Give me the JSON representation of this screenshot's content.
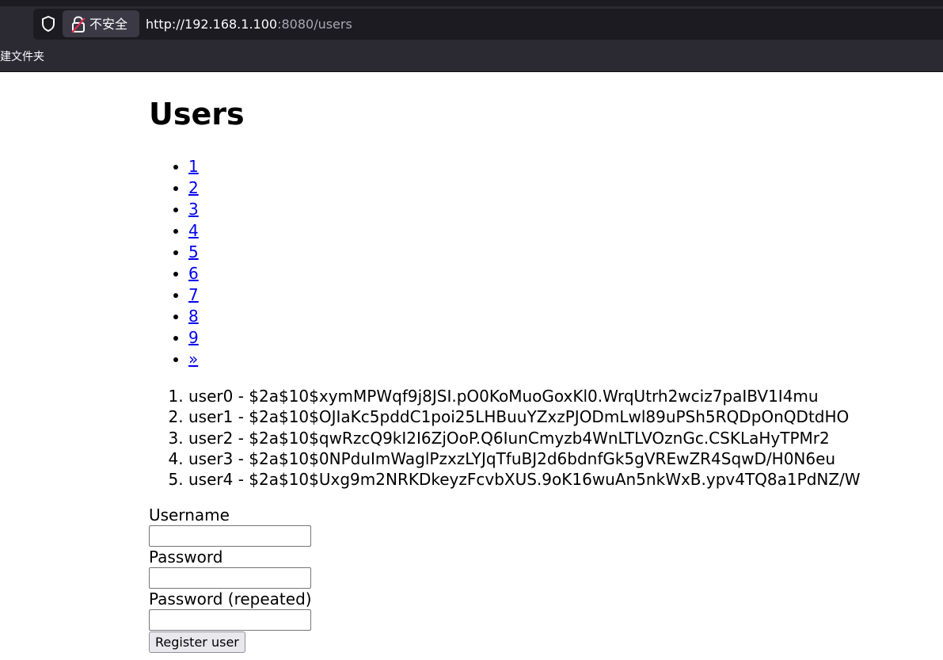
{
  "browser": {
    "security_label": "不安全",
    "url_host": "http://192.168.1.100",
    "url_rest": ":8080/users",
    "bookmark_label": "建文件夹"
  },
  "page": {
    "title": "Users",
    "pagination": [
      {
        "label": "1"
      },
      {
        "label": "2"
      },
      {
        "label": "3"
      },
      {
        "label": "4"
      },
      {
        "label": "5"
      },
      {
        "label": "6"
      },
      {
        "label": "7"
      },
      {
        "label": "8"
      },
      {
        "label": "9"
      },
      {
        "label": "»"
      }
    ],
    "users": [
      "user0 - $2a$10$xymMPWqf9j8JSI.pO0KoMuoGoxKl0.WrqUtrh2wciz7paIBV1I4mu",
      "user1 - $2a$10$OJIaKc5pddC1poi25LHBuuYZxzPJODmLwl89uPSh5RQDpOnQDtdHO",
      "user2 - $2a$10$qwRzcQ9kI2I6ZjOoP.Q6IunCmyzb4WnLTLVOznGc.CSKLaHyTPMr2",
      "user3 - $2a$10$0NPduImWaglPzxzLYJqTfuBJ2d6bdnfGk5gVREwZR4SqwD/H0N6eu",
      "user4 - $2a$10$Uxg9m2NRKDkeyzFcvbXUS.9oK16wuAn5nkWxB.ypv4TQ8a1PdNZ/W"
    ],
    "form": {
      "username_label": "Username",
      "username_value": "",
      "password_label": "Password",
      "password_value": "",
      "password_repeat_label": "Password (repeated)",
      "password_repeat_value": "",
      "submit_label": "Register user"
    }
  }
}
